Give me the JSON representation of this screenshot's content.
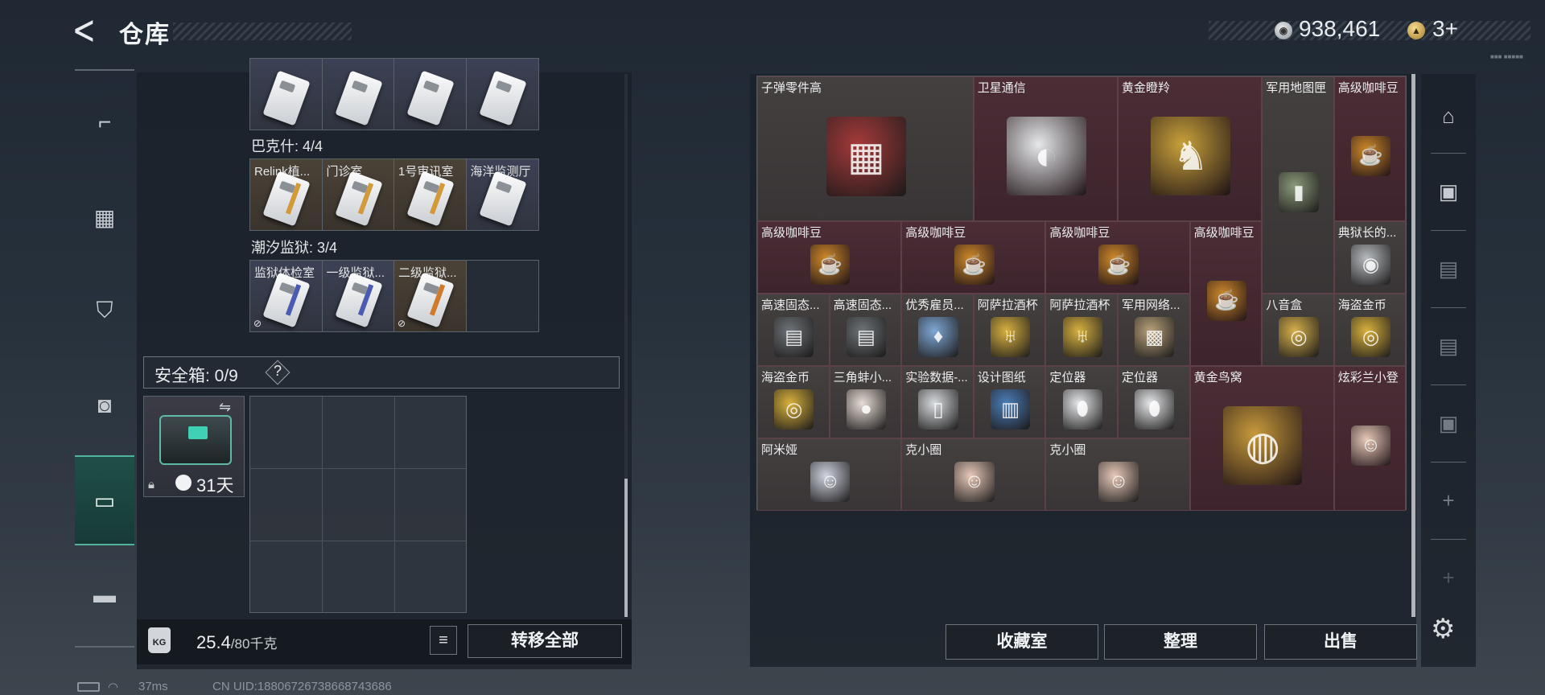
{
  "header": {
    "back_icon": "chevron-left-icon",
    "title": "仓库"
  },
  "currency": {
    "coin_amount": "938,461",
    "ticket_amount": "3+"
  },
  "watermark": "■■■ ■■■■■",
  "left_rail": {
    "items": [
      {
        "icon": "gun-icon",
        "glyph": "⌐"
      },
      {
        "icon": "vest-icon",
        "glyph": "▦"
      },
      {
        "icon": "armor-icon",
        "glyph": "⛉"
      },
      {
        "icon": "backpack-icon",
        "glyph": "◙"
      },
      {
        "icon": "safebox-icon",
        "glyph": "▭"
      },
      {
        "icon": "toolbox-icon",
        "glyph": "▬"
      }
    ]
  },
  "keycards": {
    "row0": [
      "",
      "",
      "",
      ""
    ],
    "groups": [
      {
        "title": "巴克什: 4/4",
        "cards": [
          "Relink植...",
          "门诊室",
          "1号审讯室",
          "海洋监测厅"
        ]
      },
      {
        "title": "潮汐监狱: 3/4",
        "cards": [
          "监狱体检室",
          "一级监狱...",
          "二级监狱...",
          ""
        ]
      }
    ]
  },
  "safebox": {
    "label": "安全箱: 0/9",
    "help": "?",
    "duration": "31天"
  },
  "weight": {
    "current": "25.4",
    "max": "/80千克",
    "kg_icon": "KG"
  },
  "buttons": {
    "list_icon": "≡",
    "transfer_all": "转移全部",
    "collection": "收藏室",
    "organize": "整理",
    "sell": "出售"
  },
  "stash_items": [
    {
      "name": "子弹零件高",
      "icon": "ammo-parts-icon",
      "glyph": "▦"
    },
    {
      "name": "卫星通信",
      "icon": "satellite-dish-icon",
      "glyph": "◐"
    },
    {
      "name": "黄金瞪羚",
      "icon": "golden-gazelle-icon",
      "glyph": "♞"
    },
    {
      "name": "军用地图匣",
      "icon": "map-tube-icon",
      "glyph": "▮"
    },
    {
      "name": "高级咖啡豆",
      "icon": "coffee-bag-icon",
      "glyph": "☕"
    },
    {
      "name": "高级咖啡豆",
      "icon": "coffee-bag-icon",
      "glyph": "☕"
    },
    {
      "name": "高级咖啡豆",
      "icon": "coffee-bag-icon",
      "glyph": "☕"
    },
    {
      "name": "高级咖啡豆",
      "icon": "coffee-bag-icon",
      "glyph": "☕"
    },
    {
      "name": "高级咖啡豆",
      "icon": "coffee-bag-icon",
      "glyph": "☕"
    },
    {
      "name": "典狱长的...",
      "icon": "warden-badge-icon",
      "glyph": "◉"
    },
    {
      "name": "高速固态...",
      "icon": "ssd-icon",
      "glyph": "▤"
    },
    {
      "name": "高速固态...",
      "icon": "ssd-icon",
      "glyph": "▤"
    },
    {
      "name": "优秀雇员...",
      "icon": "trophy-icon",
      "glyph": "♦"
    },
    {
      "name": "阿萨拉酒杯",
      "icon": "goblet-icon",
      "glyph": "♅"
    },
    {
      "name": "阿萨拉酒杯",
      "icon": "goblet-icon",
      "glyph": "♅"
    },
    {
      "name": "军用网络...",
      "icon": "network-module-icon",
      "glyph": "▩"
    },
    {
      "name": "八音盒",
      "icon": "music-box-icon",
      "glyph": "◎"
    },
    {
      "name": "海盗金币",
      "icon": "pirate-coin-icon",
      "glyph": "◎"
    },
    {
      "name": "海盗金币",
      "icon": "pirate-coin-icon",
      "glyph": "◎"
    },
    {
      "name": "三角蚌小...",
      "icon": "pearls-icon",
      "glyph": "●"
    },
    {
      "name": "实验数据-...",
      "icon": "usb-drive-icon",
      "glyph": "▯"
    },
    {
      "name": "设计图纸",
      "icon": "blueprint-icon",
      "glyph": "▥"
    },
    {
      "name": "定位器",
      "icon": "locator-icon",
      "glyph": "⬮"
    },
    {
      "name": "定位器",
      "icon": "locator-icon",
      "glyph": "⬮"
    },
    {
      "name": "黄金鸟窝",
      "icon": "golden-nest-icon",
      "glyph": "◍"
    },
    {
      "name": "炫彩兰小登",
      "icon": "doll-icon",
      "glyph": "☺"
    },
    {
      "name": "阿米娅",
      "icon": "bunny-doll-icon",
      "glyph": "☺"
    },
    {
      "name": "克小圈",
      "icon": "doll-icon",
      "glyph": "☺"
    },
    {
      "name": "克小圈",
      "icon": "doll-icon",
      "glyph": "☺"
    }
  ],
  "right_rail": {
    "items": [
      {
        "icon": "vault-icon",
        "glyph": "⌂"
      },
      {
        "icon": "stash-tab-IV-icon",
        "glyph": "▣"
      },
      {
        "icon": "stash-tab-IV-alt-icon",
        "glyph": "▤"
      },
      {
        "icon": "stash-tab-III-icon",
        "glyph": "▤"
      },
      {
        "icon": "stash-tab-V-icon",
        "glyph": "▣"
      },
      {
        "icon": "add-icon",
        "glyph": "+"
      },
      {
        "icon": "add-icon",
        "glyph": "+"
      }
    ]
  },
  "status": {
    "ping": "37ms",
    "uid": "CN UID:18806726738668743686"
  },
  "colors": {
    "accent_teal": "#52b39c",
    "rare_red": "#4a2b33",
    "gold": "#d39a3a"
  }
}
